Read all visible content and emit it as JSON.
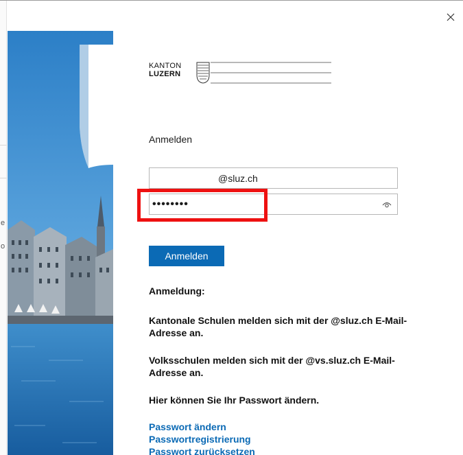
{
  "window": {
    "close_label": "×"
  },
  "logo": {
    "line1": "KANTON",
    "line2": "LUZERN"
  },
  "form": {
    "heading": "Anmelden",
    "email_value": "@sluz.ch",
    "password_value": "••••••••",
    "submit_label": "Anmelden"
  },
  "info": {
    "heading": "Anmeldung:",
    "p1": "Kantonale Schulen melden sich mit der @sluz.ch E-Mail-Adresse an.",
    "p2": "Volksschulen melden sich mit der @vs.sluz.ch E-Mail-Adresse an.",
    "p3": "Hier können Sie Ihr Passwort ändern."
  },
  "links": [
    "Passwort ändern",
    "Passwortregistrierung",
    "Passwort zurücksetzen"
  ],
  "left_strip": {
    "glyphs": [
      "e",
      "o"
    ]
  },
  "colors": {
    "accent": "#0b6ab5",
    "highlight": "#ee1111",
    "sky": "#3f8fd0"
  }
}
